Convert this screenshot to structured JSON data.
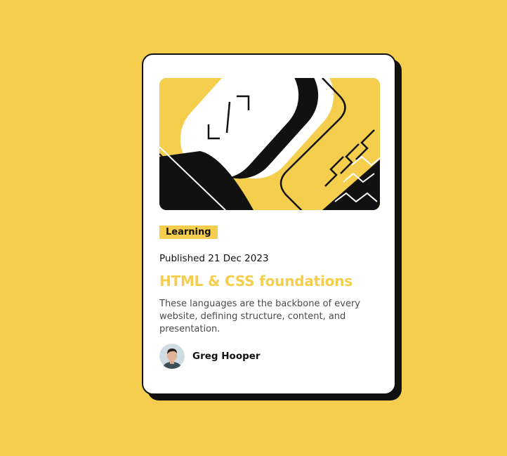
{
  "card": {
    "tag": "Learning",
    "published": "Published 21 Dec 2023",
    "title": "HTML & CSS foundations",
    "description": "These languages are the backbone of every website, defining structure, content, and presentation.",
    "author": {
      "name": "Greg Hooper"
    }
  },
  "colors": {
    "background": "#F4CE4C",
    "accent": "#F4CE4C",
    "ink": "#111111",
    "card": "#FFFFFF",
    "body_text": "#4A4A4A"
  }
}
